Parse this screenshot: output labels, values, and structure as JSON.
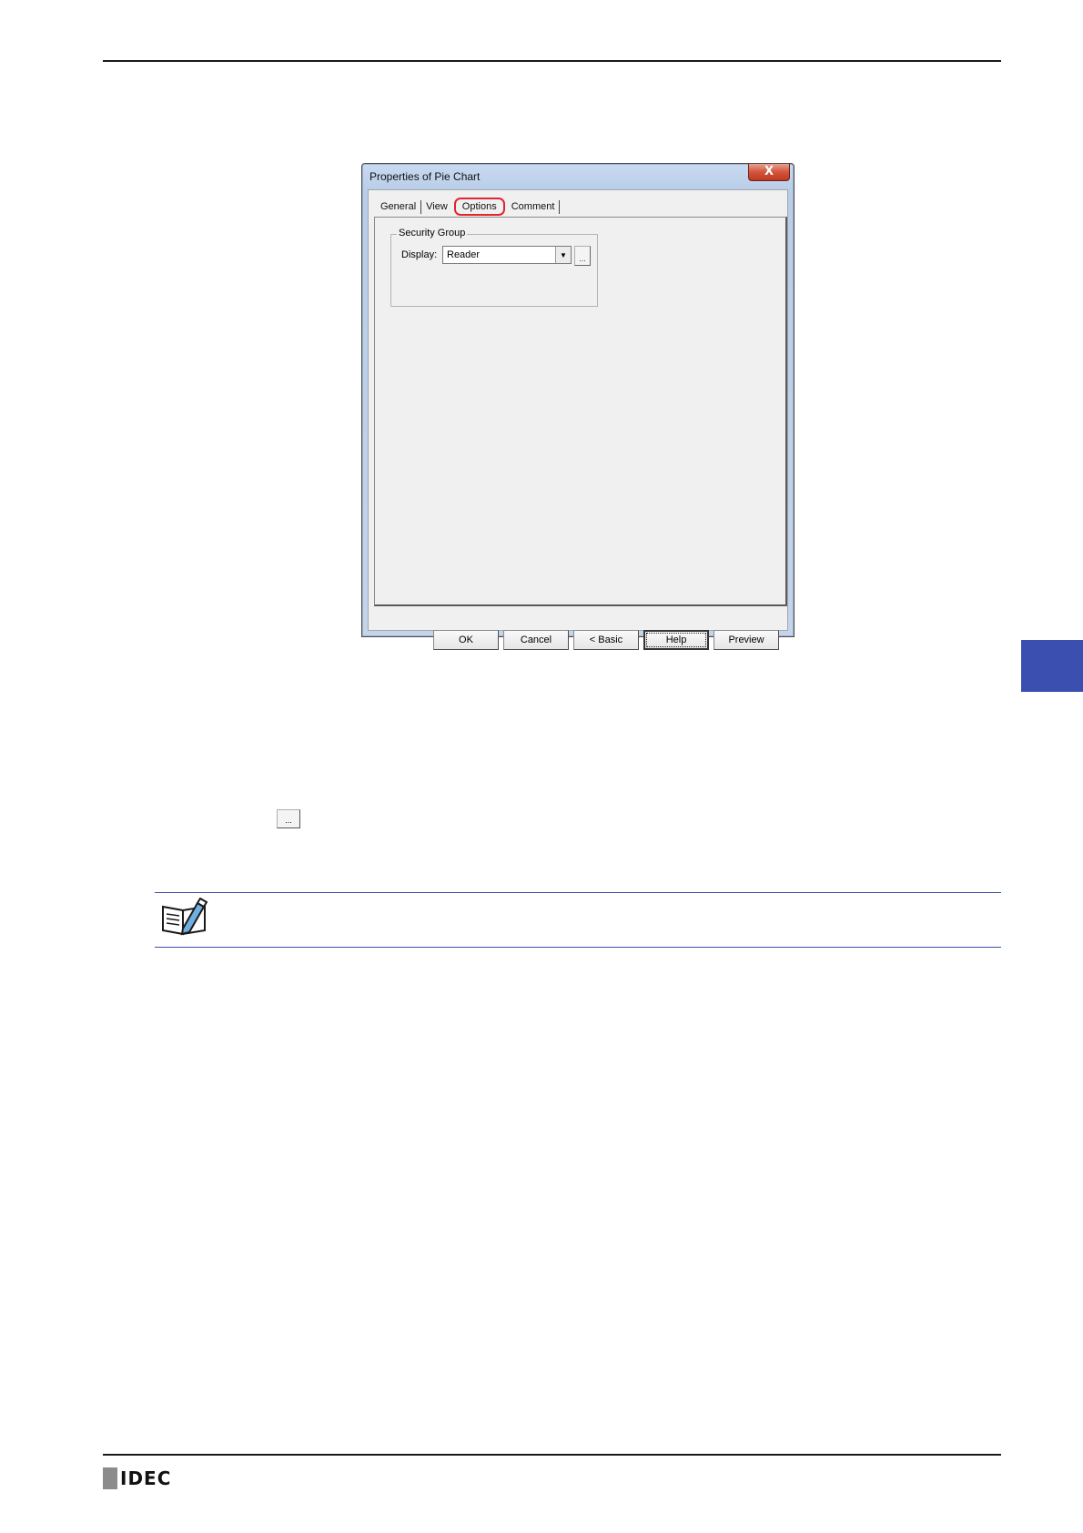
{
  "dialog": {
    "title": "Properties of Pie Chart",
    "close_glyph": "X",
    "tabs": [
      "General",
      "View",
      "Options",
      "Comment"
    ],
    "active_tab": "Options",
    "security_group": {
      "legend": "Security Group",
      "display_label": "Display:",
      "display_value": "Reader",
      "browse_label": "..."
    },
    "buttons": {
      "ok": "OK",
      "cancel": "Cancel",
      "basic": "< Basic",
      "help": "Help",
      "preview": "Preview"
    }
  },
  "body": {
    "inline_browse_label": "..."
  },
  "footer": {
    "logo_text": "IDEC"
  },
  "colors": {
    "accent_blue": "#3b4fb0",
    "highlight_red": "#e0262e"
  }
}
